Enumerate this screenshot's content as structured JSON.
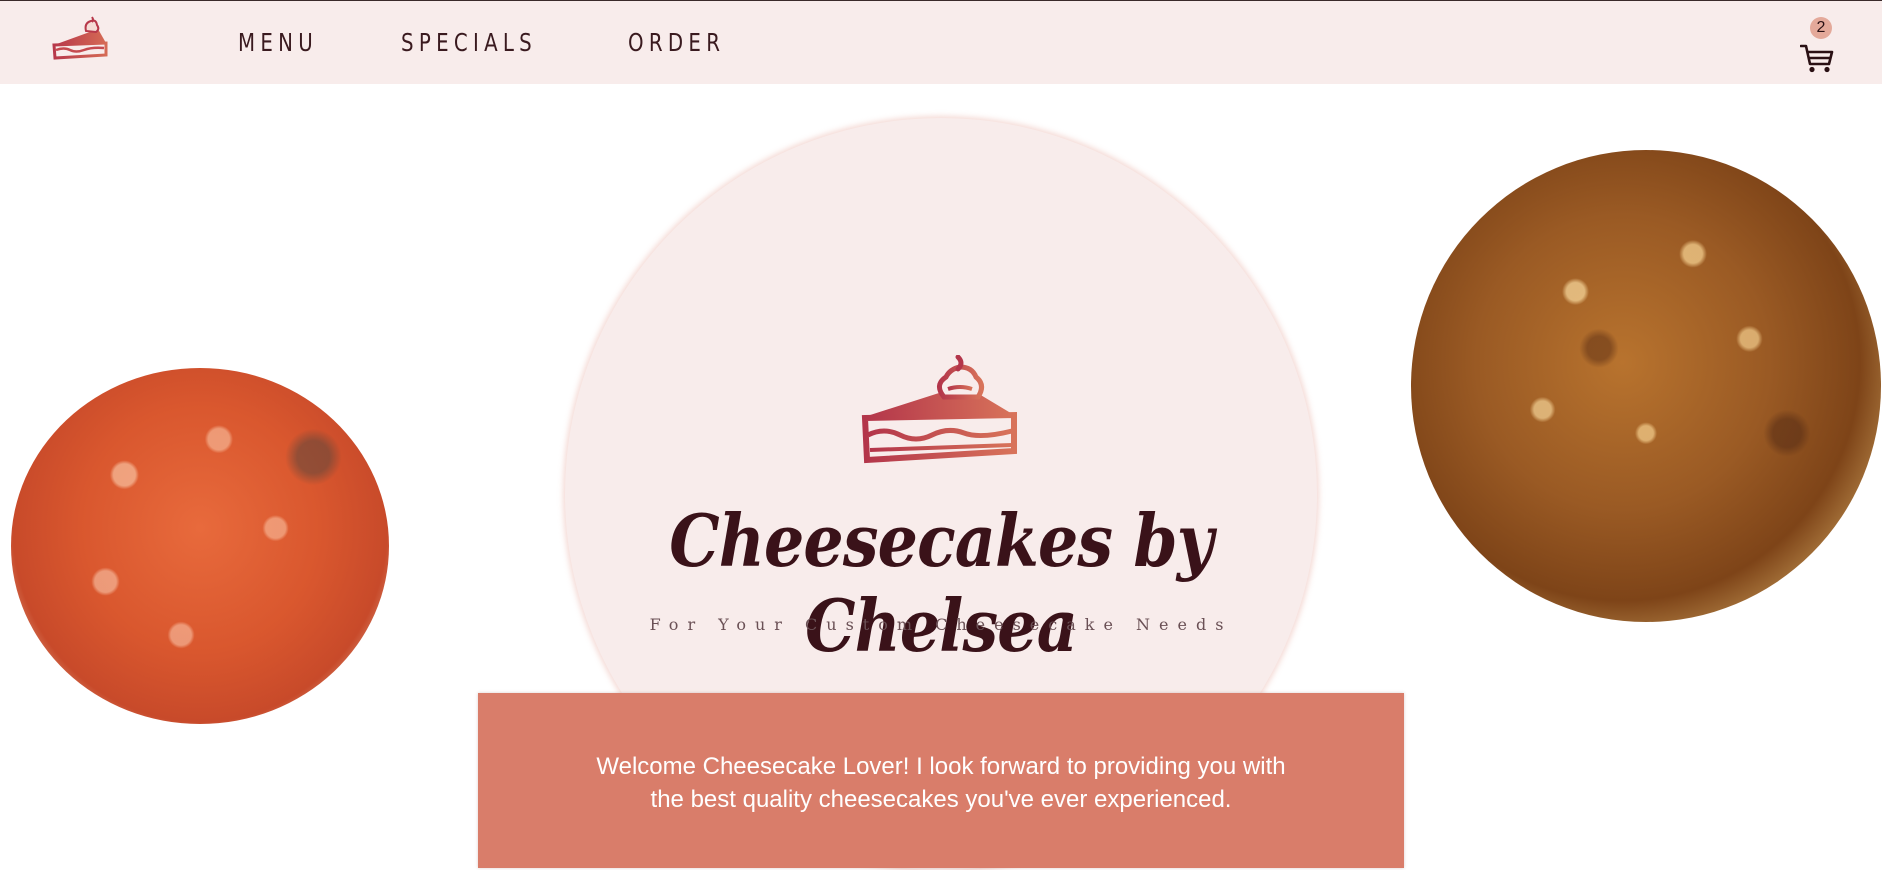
{
  "nav": {
    "links": [
      {
        "label": "MENU"
      },
      {
        "label": "SPECIALS"
      },
      {
        "label": "ORDER"
      }
    ],
    "cart_count": "2",
    "logo_icon": "cheesecake-slice-icon",
    "cart_icon": "shopping-cart-icon"
  },
  "hero": {
    "title": "Cheesecakes by Chelsea",
    "subtitle": "For Your Custom Cheesecake Needs",
    "logo_icon": "cheesecake-slice-icon"
  },
  "photos": {
    "left": "strawberry-crunch-cheesecake-photo",
    "right": "pecan-caramel-cheesecake-photo"
  },
  "welcome": {
    "text": "Welcome Cheesecake Lover! I look forward to providing you with the best quality cheesecakes you've ever experienced."
  },
  "colors": {
    "nav_bg": "#f8eceb",
    "accent": "#d97d6a",
    "title": "#3a1219",
    "badge": "#e4a99a"
  }
}
